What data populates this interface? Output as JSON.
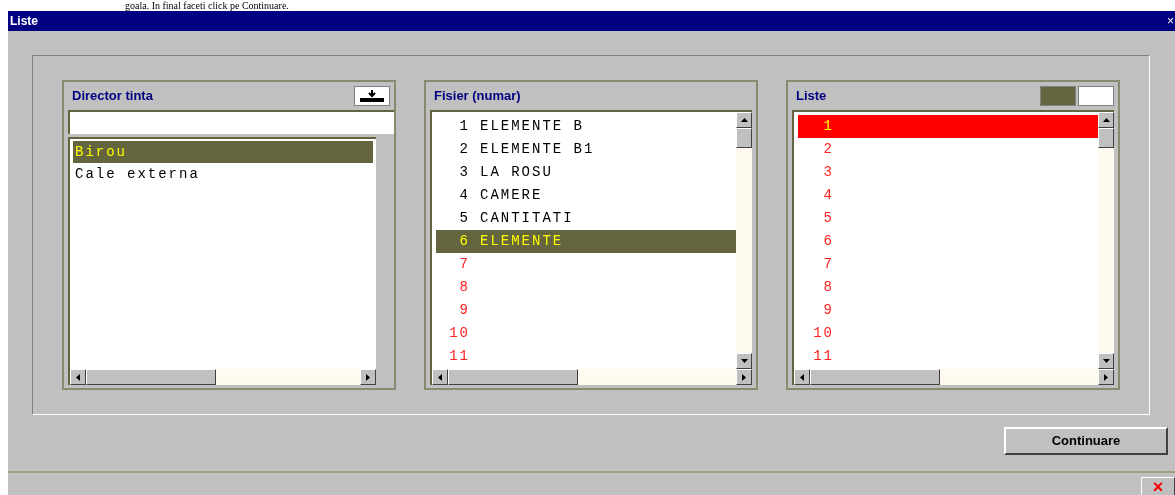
{
  "document_text": "goala. In final faceti click pe Continuare.",
  "window": {
    "title": "Liste",
    "close": "×"
  },
  "director": {
    "title": "Director tinta",
    "items": [
      {
        "label": "Birou",
        "selected": true
      },
      {
        "label": "Cale externa",
        "selected": false
      }
    ]
  },
  "fisier": {
    "title": "Fisier (numar)",
    "rows": [
      {
        "number": "1",
        "name": "ELEMENTE B",
        "kind": "file",
        "selected": false
      },
      {
        "number": "2",
        "name": "ELEMENTE B1",
        "kind": "file",
        "selected": false
      },
      {
        "number": "3",
        "name": "LA ROSU",
        "kind": "file",
        "selected": false
      },
      {
        "number": "4",
        "name": "CAMERE",
        "kind": "file",
        "selected": false
      },
      {
        "number": "5",
        "name": "CANTITATI",
        "kind": "file",
        "selected": false
      },
      {
        "number": "6",
        "name": "ELEMENTE",
        "kind": "file",
        "selected": true
      },
      {
        "number": "7",
        "kind": "empty",
        "selected": false
      },
      {
        "number": "8",
        "kind": "empty",
        "selected": false
      },
      {
        "number": "9",
        "kind": "empty",
        "selected": false
      },
      {
        "number": "10",
        "kind": "empty",
        "selected": false
      },
      {
        "number": "11",
        "kind": "empty",
        "selected": false
      }
    ]
  },
  "liste": {
    "title": "Liste",
    "swatches": [
      {
        "color": "#64643f"
      },
      {
        "color": "#ffffff"
      }
    ],
    "rows": [
      {
        "number": "1",
        "selected": true
      },
      {
        "number": "2",
        "selected": false
      },
      {
        "number": "3",
        "selected": false
      },
      {
        "number": "4",
        "selected": false
      },
      {
        "number": "5",
        "selected": false
      },
      {
        "number": "6",
        "selected": false
      },
      {
        "number": "7",
        "selected": false
      },
      {
        "number": "8",
        "selected": false
      },
      {
        "number": "9",
        "selected": false
      },
      {
        "number": "10",
        "selected": false
      },
      {
        "number": "11",
        "selected": false
      }
    ]
  },
  "continue_button": "Continuare",
  "footer_close": "×"
}
